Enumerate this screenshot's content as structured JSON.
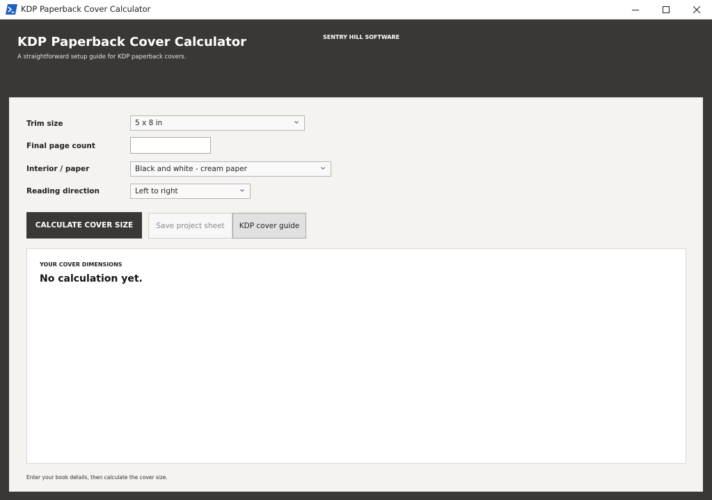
{
  "window": {
    "title": "KDP Paperback Cover Calculator",
    "icon": "powershell-icon",
    "controls": [
      "minimize-icon",
      "maximize-icon",
      "close-icon"
    ]
  },
  "header": {
    "title": "KDP Paperback Cover Calculator",
    "subtitle": "A straightforward setup guide for KDP paperback covers.",
    "vendor": "SENTRY HILL SOFTWARE"
  },
  "form": {
    "trim_size": {
      "label": "Trim size",
      "value": "5 x 8 in"
    },
    "page_count": {
      "label": "Final page count",
      "value": "",
      "placeholder": ""
    },
    "interior": {
      "label": "Interior / paper",
      "value": "Black and white - cream paper"
    },
    "reading_direction": {
      "label": "Reading direction",
      "value": "Left to right"
    }
  },
  "actions": {
    "calculate_label": "CALCULATE COVER SIZE",
    "save_label": "Save project sheet",
    "guide_label": "KDP cover guide"
  },
  "results": {
    "heading": "YOUR COVER DIMENSIONS",
    "value": "No calculation yet."
  },
  "status_text": "Enter your book details, then calculate the cover size.",
  "colors": {
    "header_bg": "#3a3837",
    "panel_bg": "#f5f3ef",
    "primary_button": "#3a3837",
    "app_icon": "#1f5fbf"
  }
}
